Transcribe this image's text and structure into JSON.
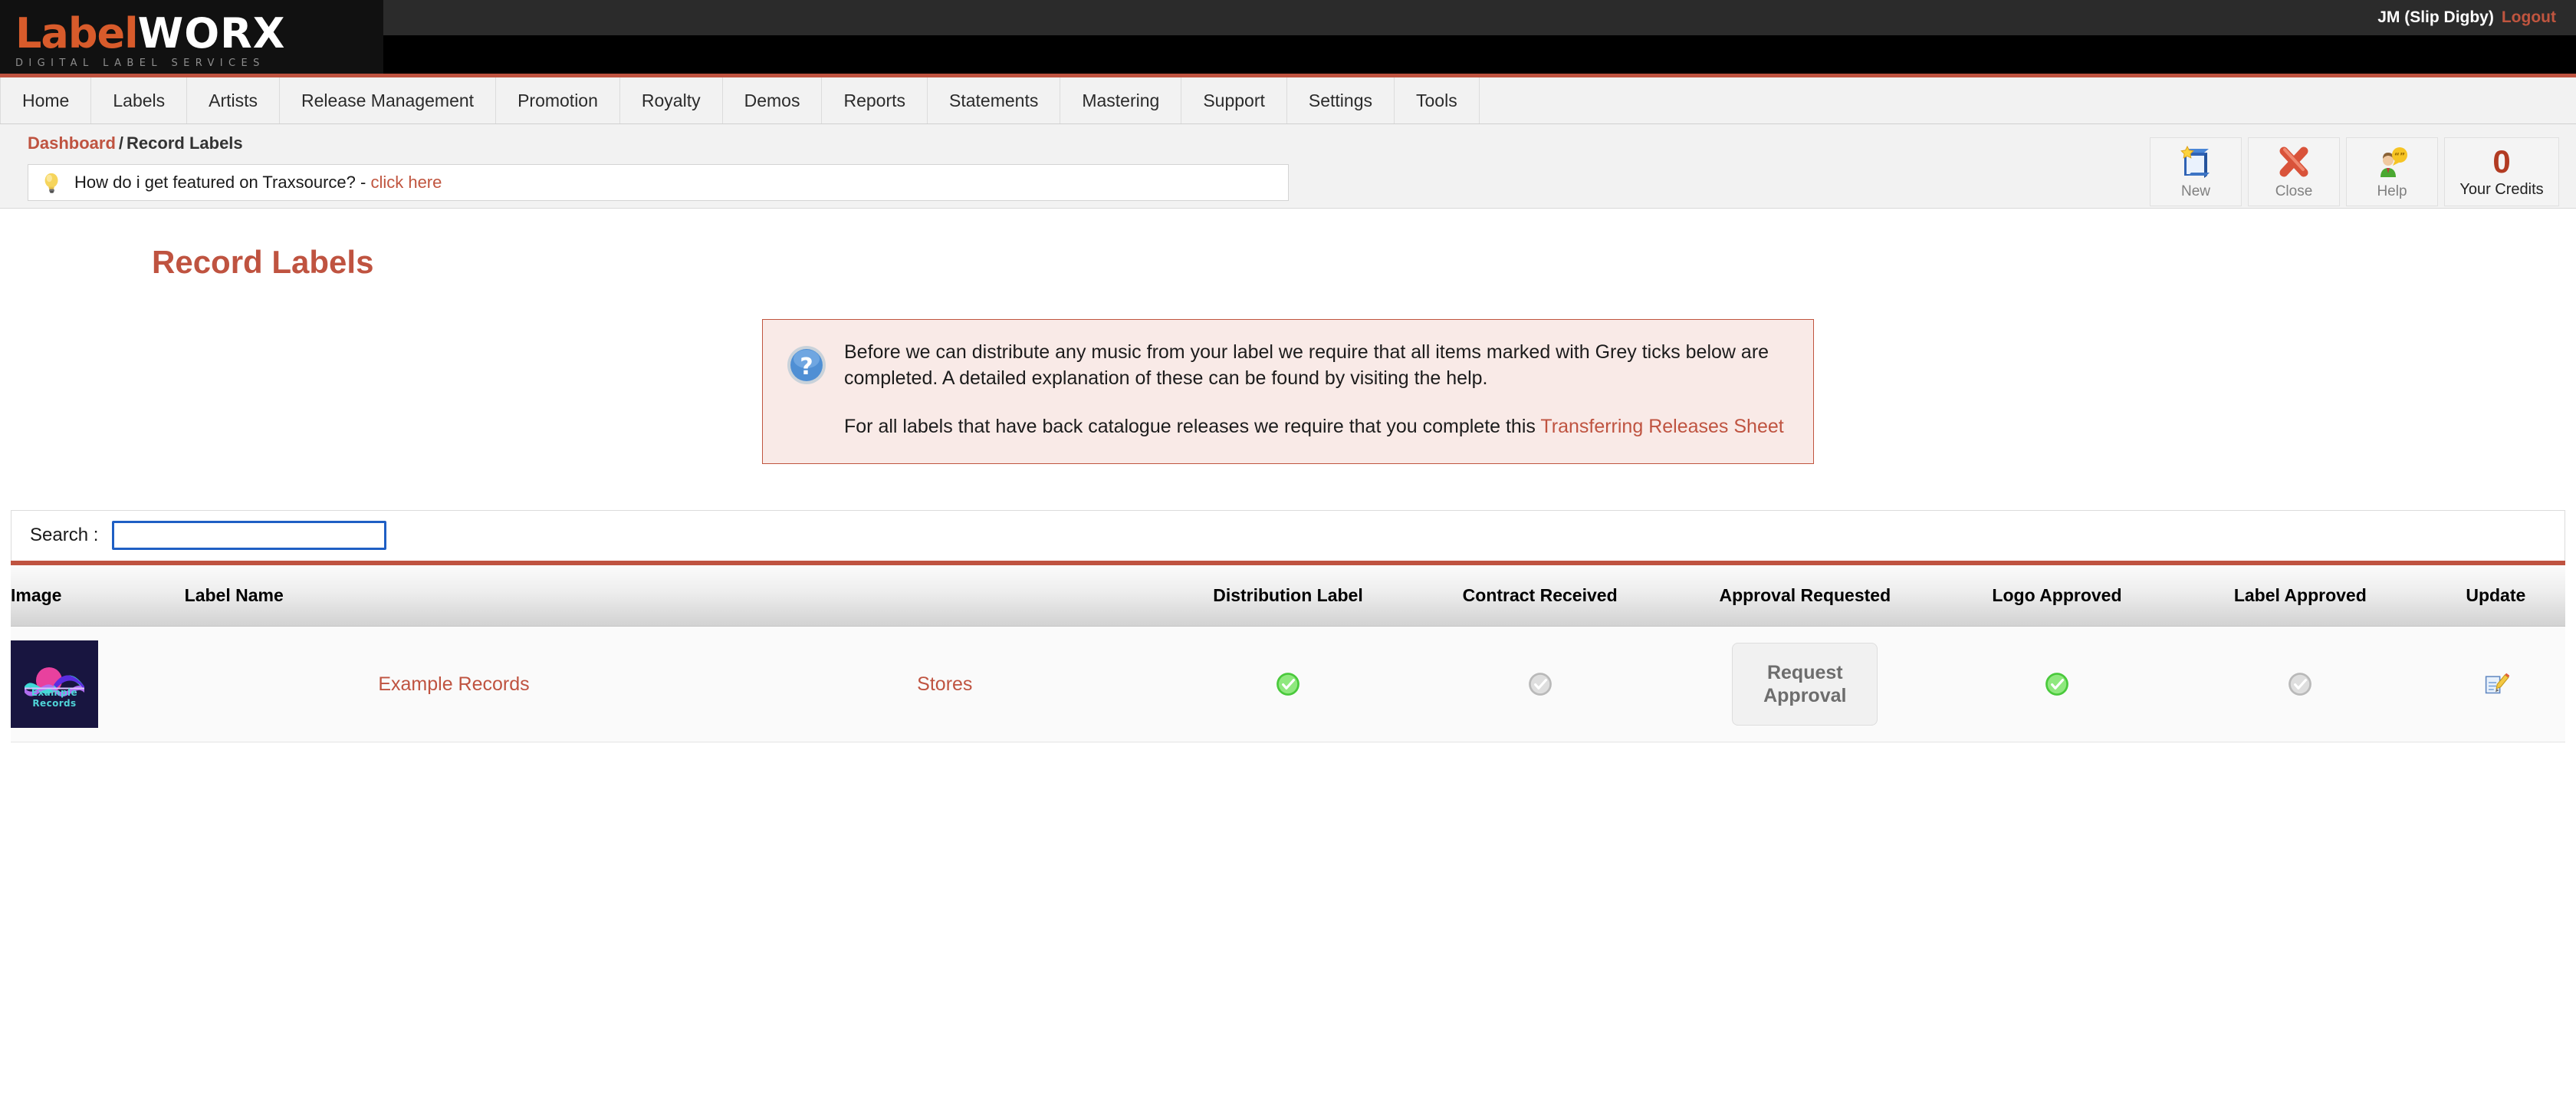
{
  "brand": {
    "logo_primary": "Label",
    "logo_secondary": "WORX",
    "tagline": "DIGITAL LABEL SERVICES",
    "accent_orange": "#d85b2b",
    "accent_red": "#bf5340"
  },
  "account": {
    "user": "JM (Slip Digby)",
    "logout_label": "Logout"
  },
  "nav": {
    "items": [
      {
        "label": "Home"
      },
      {
        "label": "Labels"
      },
      {
        "label": "Artists"
      },
      {
        "label": "Release Management"
      },
      {
        "label": "Promotion"
      },
      {
        "label": "Royalty"
      },
      {
        "label": "Demos"
      },
      {
        "label": "Reports"
      },
      {
        "label": "Statements"
      },
      {
        "label": "Mastering"
      },
      {
        "label": "Support"
      },
      {
        "label": "Settings"
      },
      {
        "label": "Tools"
      }
    ]
  },
  "breadcrumb": {
    "root": "Dashboard",
    "separator": "/",
    "current": "Record Labels"
  },
  "notice": {
    "icon": "lightbulb-icon",
    "text": "How do i get featured on Traxsource? -",
    "link_label": "click here"
  },
  "toolbar": {
    "new_label": "New",
    "new_icon": "new-folder-star-icon",
    "close_label": "Close",
    "close_icon": "red-cross-icon",
    "help_label": "Help",
    "help_icon": "person-speech-bubble-icon",
    "credits_value": "0",
    "credits_label": "Your Credits"
  },
  "page": {
    "title": "Record Labels"
  },
  "infobox": {
    "icon": "question-mark-icon",
    "paragraph_1": "Before we can distribute any music from your label we require that all items marked with Grey ticks below are completed. A detailed explanation of these can be found by visiting the help.",
    "paragraph_2_prefix": "For all labels that have back catalogue releases we require that you complete this",
    "paragraph_2_link": "Transferring Releases Sheet"
  },
  "search": {
    "label": "Search :",
    "value": "",
    "placeholder": ""
  },
  "table": {
    "columns": [
      {
        "key": "image",
        "label": "Image"
      },
      {
        "key": "name",
        "label": "Label Name"
      },
      {
        "key": "stores",
        "label": ""
      },
      {
        "key": "distribution_label",
        "label": "Distribution Label"
      },
      {
        "key": "contract_received",
        "label": "Contract Received"
      },
      {
        "key": "approval_requested",
        "label": "Approval Requested"
      },
      {
        "key": "logo_approved",
        "label": "Logo Approved"
      },
      {
        "key": "label_approved",
        "label": "Label Approved"
      },
      {
        "key": "update",
        "label": "Update"
      }
    ],
    "rows": [
      {
        "image_alt": "Example Records",
        "thumb_line_1": "Example",
        "thumb_line_2": "Records",
        "name": "Example Records",
        "stores_link": "Stores",
        "distribution_label_status": "green-tick",
        "contract_received_status": "grey-tick",
        "approval_requested_button": "Request Approval",
        "logo_approved_status": "green-tick",
        "label_approved_status": "grey-tick",
        "update_icon": "edit-document-pencil-icon"
      }
    ]
  }
}
